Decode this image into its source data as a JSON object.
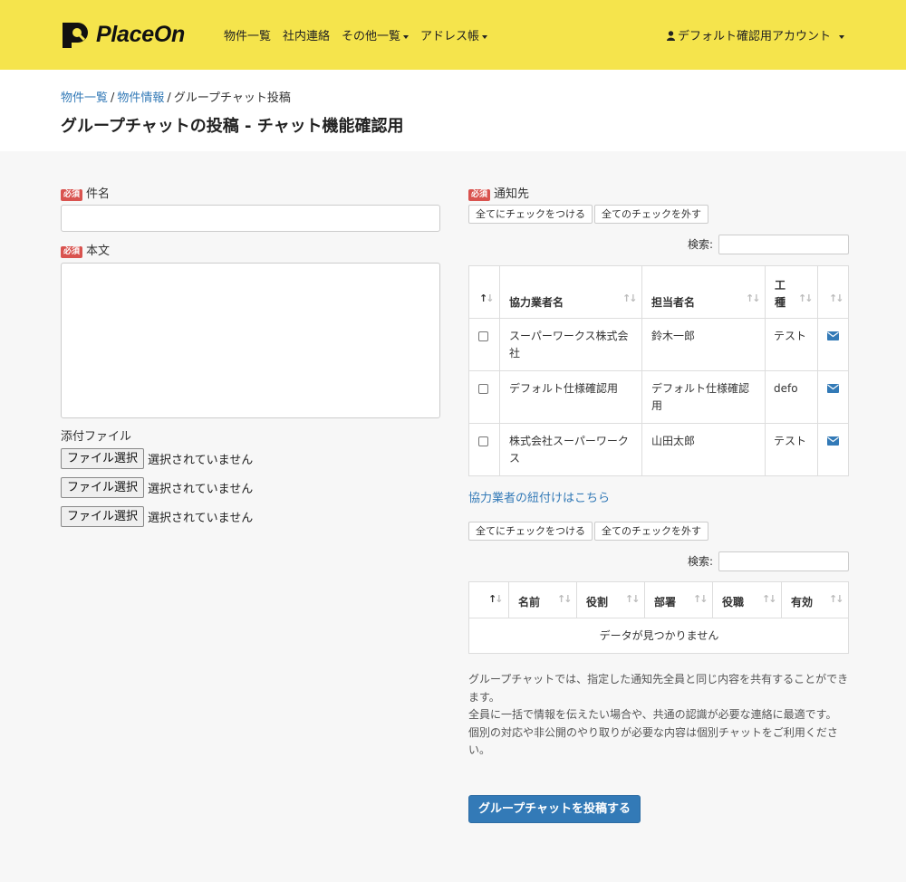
{
  "navbar": {
    "logo_text": "PlaceOn",
    "items": [
      {
        "label": "物件一覧",
        "dropdown": false
      },
      {
        "label": "社内連絡",
        "dropdown": false
      },
      {
        "label": "その他一覧",
        "dropdown": true
      },
      {
        "label": "アドレス帳",
        "dropdown": true
      }
    ],
    "account": "デフォルト確認用アカウント",
    "bg_color": "#f5e44c"
  },
  "breadcrumb": {
    "items": [
      {
        "label": "物件一覧",
        "link": true
      },
      {
        "label": "物件情報",
        "link": true
      },
      {
        "label": "グループチャット投稿",
        "link": false
      }
    ]
  },
  "page_title": "グループチャットの投稿 - チャット機能確認用",
  "form": {
    "required_badge": "必須",
    "subject_label": "件名",
    "subject_value": "",
    "body_label": "本文",
    "body_value": "",
    "attachments_label": "添付ファイル",
    "file_inputs": [
      {
        "button": "ファイル選択",
        "status": "選択されていません"
      },
      {
        "button": "ファイル選択",
        "status": "選択されていません"
      },
      {
        "button": "ファイル選択",
        "status": "選択されていません"
      }
    ]
  },
  "notify": {
    "label": "通知先",
    "check_all": "全てにチェックをつける",
    "uncheck_all": "全てのチェックを外す",
    "search_label": "検索:",
    "partners_table": {
      "headers": [
        "協力業者名",
        "担当者名",
        "工種"
      ],
      "rows": [
        {
          "company": "スーパーワークス株式会社",
          "person": "鈴木一郎",
          "trade": "テスト"
        },
        {
          "company": "デフォルト仕様確認用",
          "person": "デフォルト仕様確認用",
          "trade": "defo"
        },
        {
          "company": "株式会社スーパーワークス",
          "person": "山田太郎",
          "trade": "テスト"
        }
      ]
    },
    "partner_link": "協力業者の紐付けはこちら",
    "check_all_2": "全てにチェックをつける",
    "uncheck_all_2": "全てのチェックを外す",
    "search_label_2": "検索:",
    "members_table": {
      "headers": [
        "名前",
        "役割",
        "部署",
        "役職",
        "有効"
      ],
      "empty": "データが見つかりません"
    }
  },
  "description": [
    "グループチャットでは、指定した通知先全員と同じ内容を共有することができます。",
    "全員に一括で情報を伝えたい場合や、共通の認識が必要な連絡に最適です。",
    "個別の対応や非公開のやり取りが必要な内容は個別チャットをご利用ください。"
  ],
  "submit_label": "グループチャットを投稿する",
  "colors": {
    "primary": "#337ab7",
    "required": "#d9534f"
  }
}
